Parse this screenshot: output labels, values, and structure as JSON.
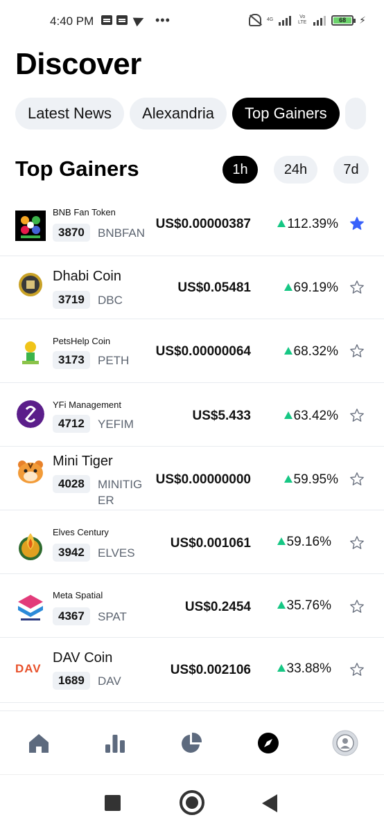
{
  "status_bar": {
    "time": "4:40 PM",
    "network_label": "4G",
    "lte_label": "Vo LTE",
    "battery": "68"
  },
  "title": "Discover",
  "categories": [
    "Latest News",
    "Alexandria",
    "Top Gainers"
  ],
  "active_category": "Top Gainers",
  "section": {
    "title": "Top Gainers",
    "periods": [
      "1h",
      "24h",
      "7d"
    ],
    "active_period": "1h"
  },
  "coins": [
    {
      "name": "BNB Fan Token",
      "rank": "3870",
      "symbol": "BNBFAN",
      "price": "US$0.00000387",
      "change": "112.39%",
      "favorite": true
    },
    {
      "name": "Dhabi Coin",
      "rank": "3719",
      "symbol": "DBC",
      "price": "US$0.05481",
      "change": "69.19%",
      "favorite": false
    },
    {
      "name": "PetsHelp Coin",
      "rank": "3173",
      "symbol": "PETH",
      "price": "US$0.00000064",
      "change": "68.32%",
      "favorite": false
    },
    {
      "name": "YFi Management",
      "rank": "4712",
      "symbol": "YEFIM",
      "price": "US$5.433",
      "change": "63.42%",
      "favorite": false
    },
    {
      "name": "Mini Tiger",
      "rank": "4028",
      "symbol_line1": "MINITIG",
      "symbol_line2": "ER",
      "price": "US$0.00000000",
      "change": "59.95%",
      "favorite": false
    },
    {
      "name": "Elves Century",
      "rank": "3942",
      "symbol": "ELVES",
      "price": "US$0.001061",
      "change": "59.16%",
      "favorite": false
    },
    {
      "name": "Meta Spatial",
      "rank": "4367",
      "symbol": "SPAT",
      "price": "US$0.2454",
      "change": "35.76%",
      "favorite": false
    },
    {
      "name": "DAV Coin",
      "rank": "1689",
      "symbol": "DAV",
      "logo_text": "DAV",
      "price": "US$0.002106",
      "change": "33.88%",
      "favorite": false
    }
  ],
  "bottom_nav": [
    "home-icon",
    "bar-chart-icon",
    "pie-chart-icon",
    "compass-icon",
    "profile-avatar-icon"
  ],
  "bottom_nav_active": "compass-icon",
  "colors": {
    "positive": "#16c784",
    "favorite_star": "#3861fb",
    "chip_bg": "#eef1f5",
    "active_bg": "#000000"
  }
}
